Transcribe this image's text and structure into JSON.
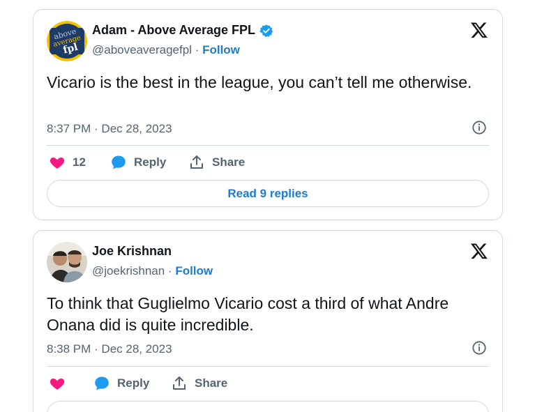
{
  "tweets": [
    {
      "author_name": "Adam - Above Average FPL",
      "verified": true,
      "handle": "@aboveaveragefpl",
      "separator": " · ",
      "follow_label": "Follow",
      "avatar_text": [
        "above",
        "average",
        "fpl"
      ],
      "text": "Vicario is the best in the league, you can’t tell me otherwise.",
      "timestamp": "8:37 PM · Dec 28, 2023",
      "like_count": "12",
      "reply_label": "Reply",
      "share_label": "Share",
      "read_replies_label": "Read 9 replies"
    },
    {
      "author_name": "Joe Krishnan",
      "verified": false,
      "handle": "@joekrishnan",
      "separator": " · ",
      "follow_label": "Follow",
      "text": "To think that Guglielmo Vicario cost a third of what Andre Onana did is quite incredible.",
      "timestamp": "8:38 PM · Dec 28, 2023",
      "reply_label": "Reply",
      "share_label": "Share"
    }
  ],
  "colors": {
    "link": "#1d7bd0",
    "like": "#f91880",
    "reply": "#1d9bf0",
    "text": "#0f1419",
    "muted": "#536471",
    "border": "#cfd9de"
  },
  "icons": [
    "x-logo-icon",
    "verified-badge-icon",
    "info-icon",
    "heart-icon",
    "reply-bubble-icon",
    "share-icon"
  ]
}
